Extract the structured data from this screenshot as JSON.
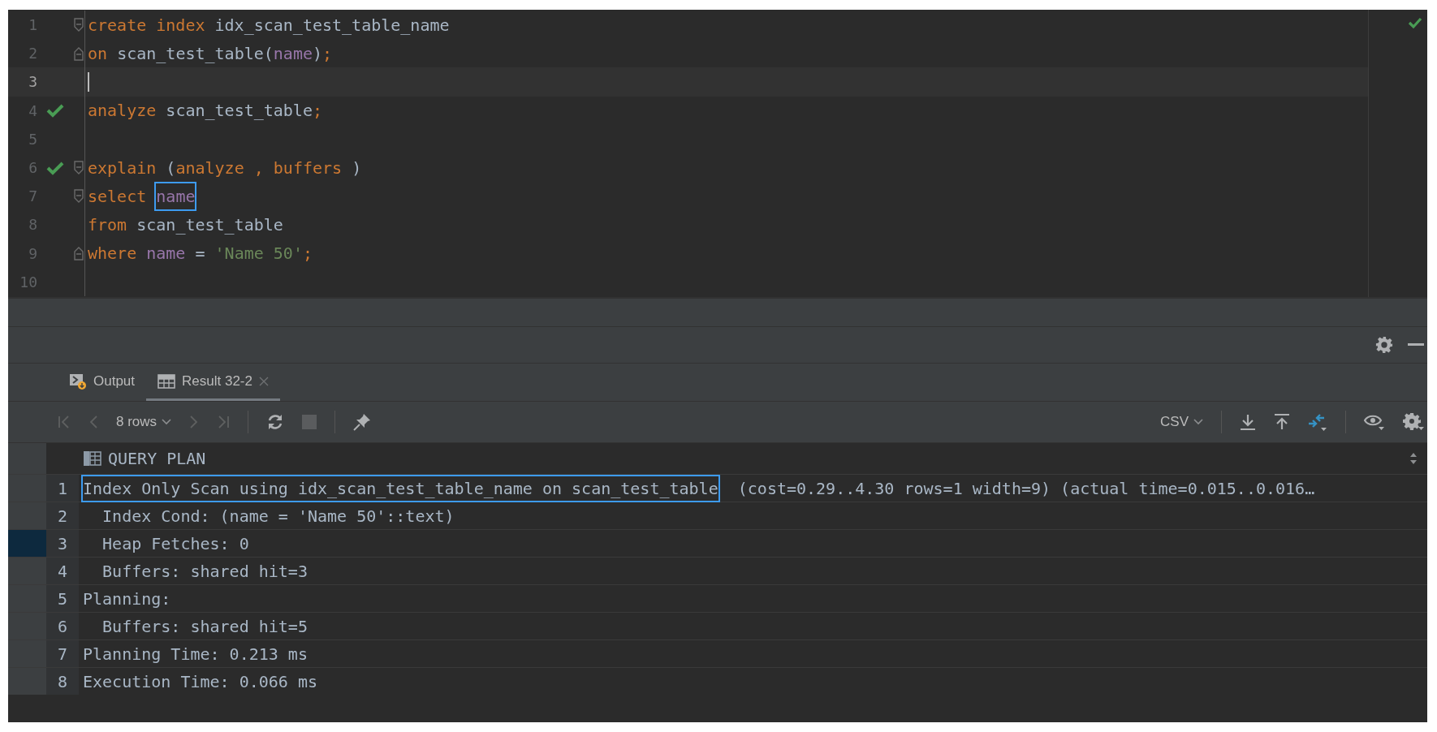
{
  "editor": {
    "inspection_ok": true,
    "lines": [
      {
        "number": "1",
        "run_ok": false,
        "fold_open": true,
        "fold_close": false,
        "current": false,
        "tokens": [
          {
            "text": "create index",
            "kind": "keyword"
          },
          {
            "text": " idx_scan_test_table_name",
            "kind": "ident"
          }
        ]
      },
      {
        "number": "2",
        "run_ok": false,
        "fold_open": false,
        "fold_close": true,
        "current": false,
        "tokens": [
          {
            "text": "on",
            "kind": "keyword"
          },
          {
            "text": " scan_test_table(",
            "kind": "ident"
          },
          {
            "text": "name",
            "kind": "column"
          },
          {
            "text": ")",
            "kind": "ident"
          },
          {
            "text": ";",
            "kind": "keyword"
          }
        ]
      },
      {
        "number": "3",
        "run_ok": false,
        "fold_open": false,
        "fold_close": false,
        "current": true
      },
      {
        "number": "4",
        "run_ok": true,
        "fold_open": false,
        "fold_close": false,
        "current": false,
        "tokens": [
          {
            "text": "analyze",
            "kind": "keyword"
          },
          {
            "text": " scan_test_table",
            "kind": "ident"
          },
          {
            "text": ";",
            "kind": "keyword"
          }
        ]
      },
      {
        "number": "5",
        "run_ok": false,
        "fold_open": false,
        "fold_close": false,
        "current": false
      },
      {
        "number": "6",
        "run_ok": true,
        "fold_open": true,
        "fold_close": false,
        "current": false,
        "tokens": [
          {
            "text": "explain",
            "kind": "keyword"
          },
          {
            "text": " (",
            "kind": "ident"
          },
          {
            "text": "analyze , buffers",
            "kind": "keyword"
          },
          {
            "text": " )",
            "kind": "ident"
          }
        ]
      },
      {
        "number": "7",
        "run_ok": false,
        "fold_open": true,
        "fold_close": false,
        "current": false,
        "tokens": [
          {
            "text": "select ",
            "kind": "keyword"
          },
          {
            "text": "name",
            "kind": "column",
            "boxed": true
          }
        ]
      },
      {
        "number": "8",
        "run_ok": false,
        "fold_open": false,
        "fold_close": false,
        "current": false,
        "tokens": [
          {
            "text": "from",
            "kind": "keyword"
          },
          {
            "text": " scan_test_table",
            "kind": "ident"
          }
        ]
      },
      {
        "number": "9",
        "run_ok": false,
        "fold_open": false,
        "fold_close": true,
        "current": false,
        "tokens": [
          {
            "text": "where ",
            "kind": "keyword"
          },
          {
            "text": "name",
            "kind": "column"
          },
          {
            "text": " = ",
            "kind": "ident"
          },
          {
            "text": "'Name 50'",
            "kind": "string"
          },
          {
            "text": ";",
            "kind": "keyword"
          }
        ]
      },
      {
        "number": "10",
        "run_ok": false,
        "fold_open": false,
        "fold_close": false,
        "current": false
      }
    ]
  },
  "tabs": [
    {
      "label": "Output",
      "kind": "output",
      "selected": false,
      "closable": false
    },
    {
      "label": "Result 32-2",
      "kind": "table",
      "selected": true,
      "closable": true
    }
  ],
  "toolbar": {
    "rows_label": "8 rows",
    "format_label": "CSV"
  },
  "result": {
    "column": "QUERY PLAN",
    "rows": [
      {
        "number": "1",
        "selected": false,
        "segments": [
          {
            "text": "Index Only Scan using idx_scan_test_table_name on scan_test_table",
            "boxed": true
          },
          {
            "text": "  (cost=0.29..4.30 rows=1 width=9) (actual time=0.015..0.016…",
            "boxed": false
          }
        ]
      },
      {
        "number": "2",
        "selected": false,
        "segments": [
          {
            "text": "  Index Cond: (name = 'Name 50'::text)",
            "boxed": false
          }
        ]
      },
      {
        "number": "3",
        "selected": true,
        "segments": [
          {
            "text": "  Heap Fetches: 0",
            "boxed": false
          }
        ]
      },
      {
        "number": "4",
        "selected": false,
        "segments": [
          {
            "text": "  Buffers: shared hit=3",
            "boxed": false
          }
        ]
      },
      {
        "number": "5",
        "selected": false,
        "segments": [
          {
            "text": "Planning:",
            "boxed": false
          }
        ]
      },
      {
        "number": "6",
        "selected": false,
        "segments": [
          {
            "text": "  Buffers: shared hit=5",
            "boxed": false
          }
        ]
      },
      {
        "number": "7",
        "selected": false,
        "segments": [
          {
            "text": "Planning Time: 0.213 ms",
            "boxed": false
          }
        ]
      },
      {
        "number": "8",
        "selected": false,
        "segments": [
          {
            "text": "Execution Time: 0.066 ms",
            "boxed": false
          }
        ]
      }
    ]
  }
}
